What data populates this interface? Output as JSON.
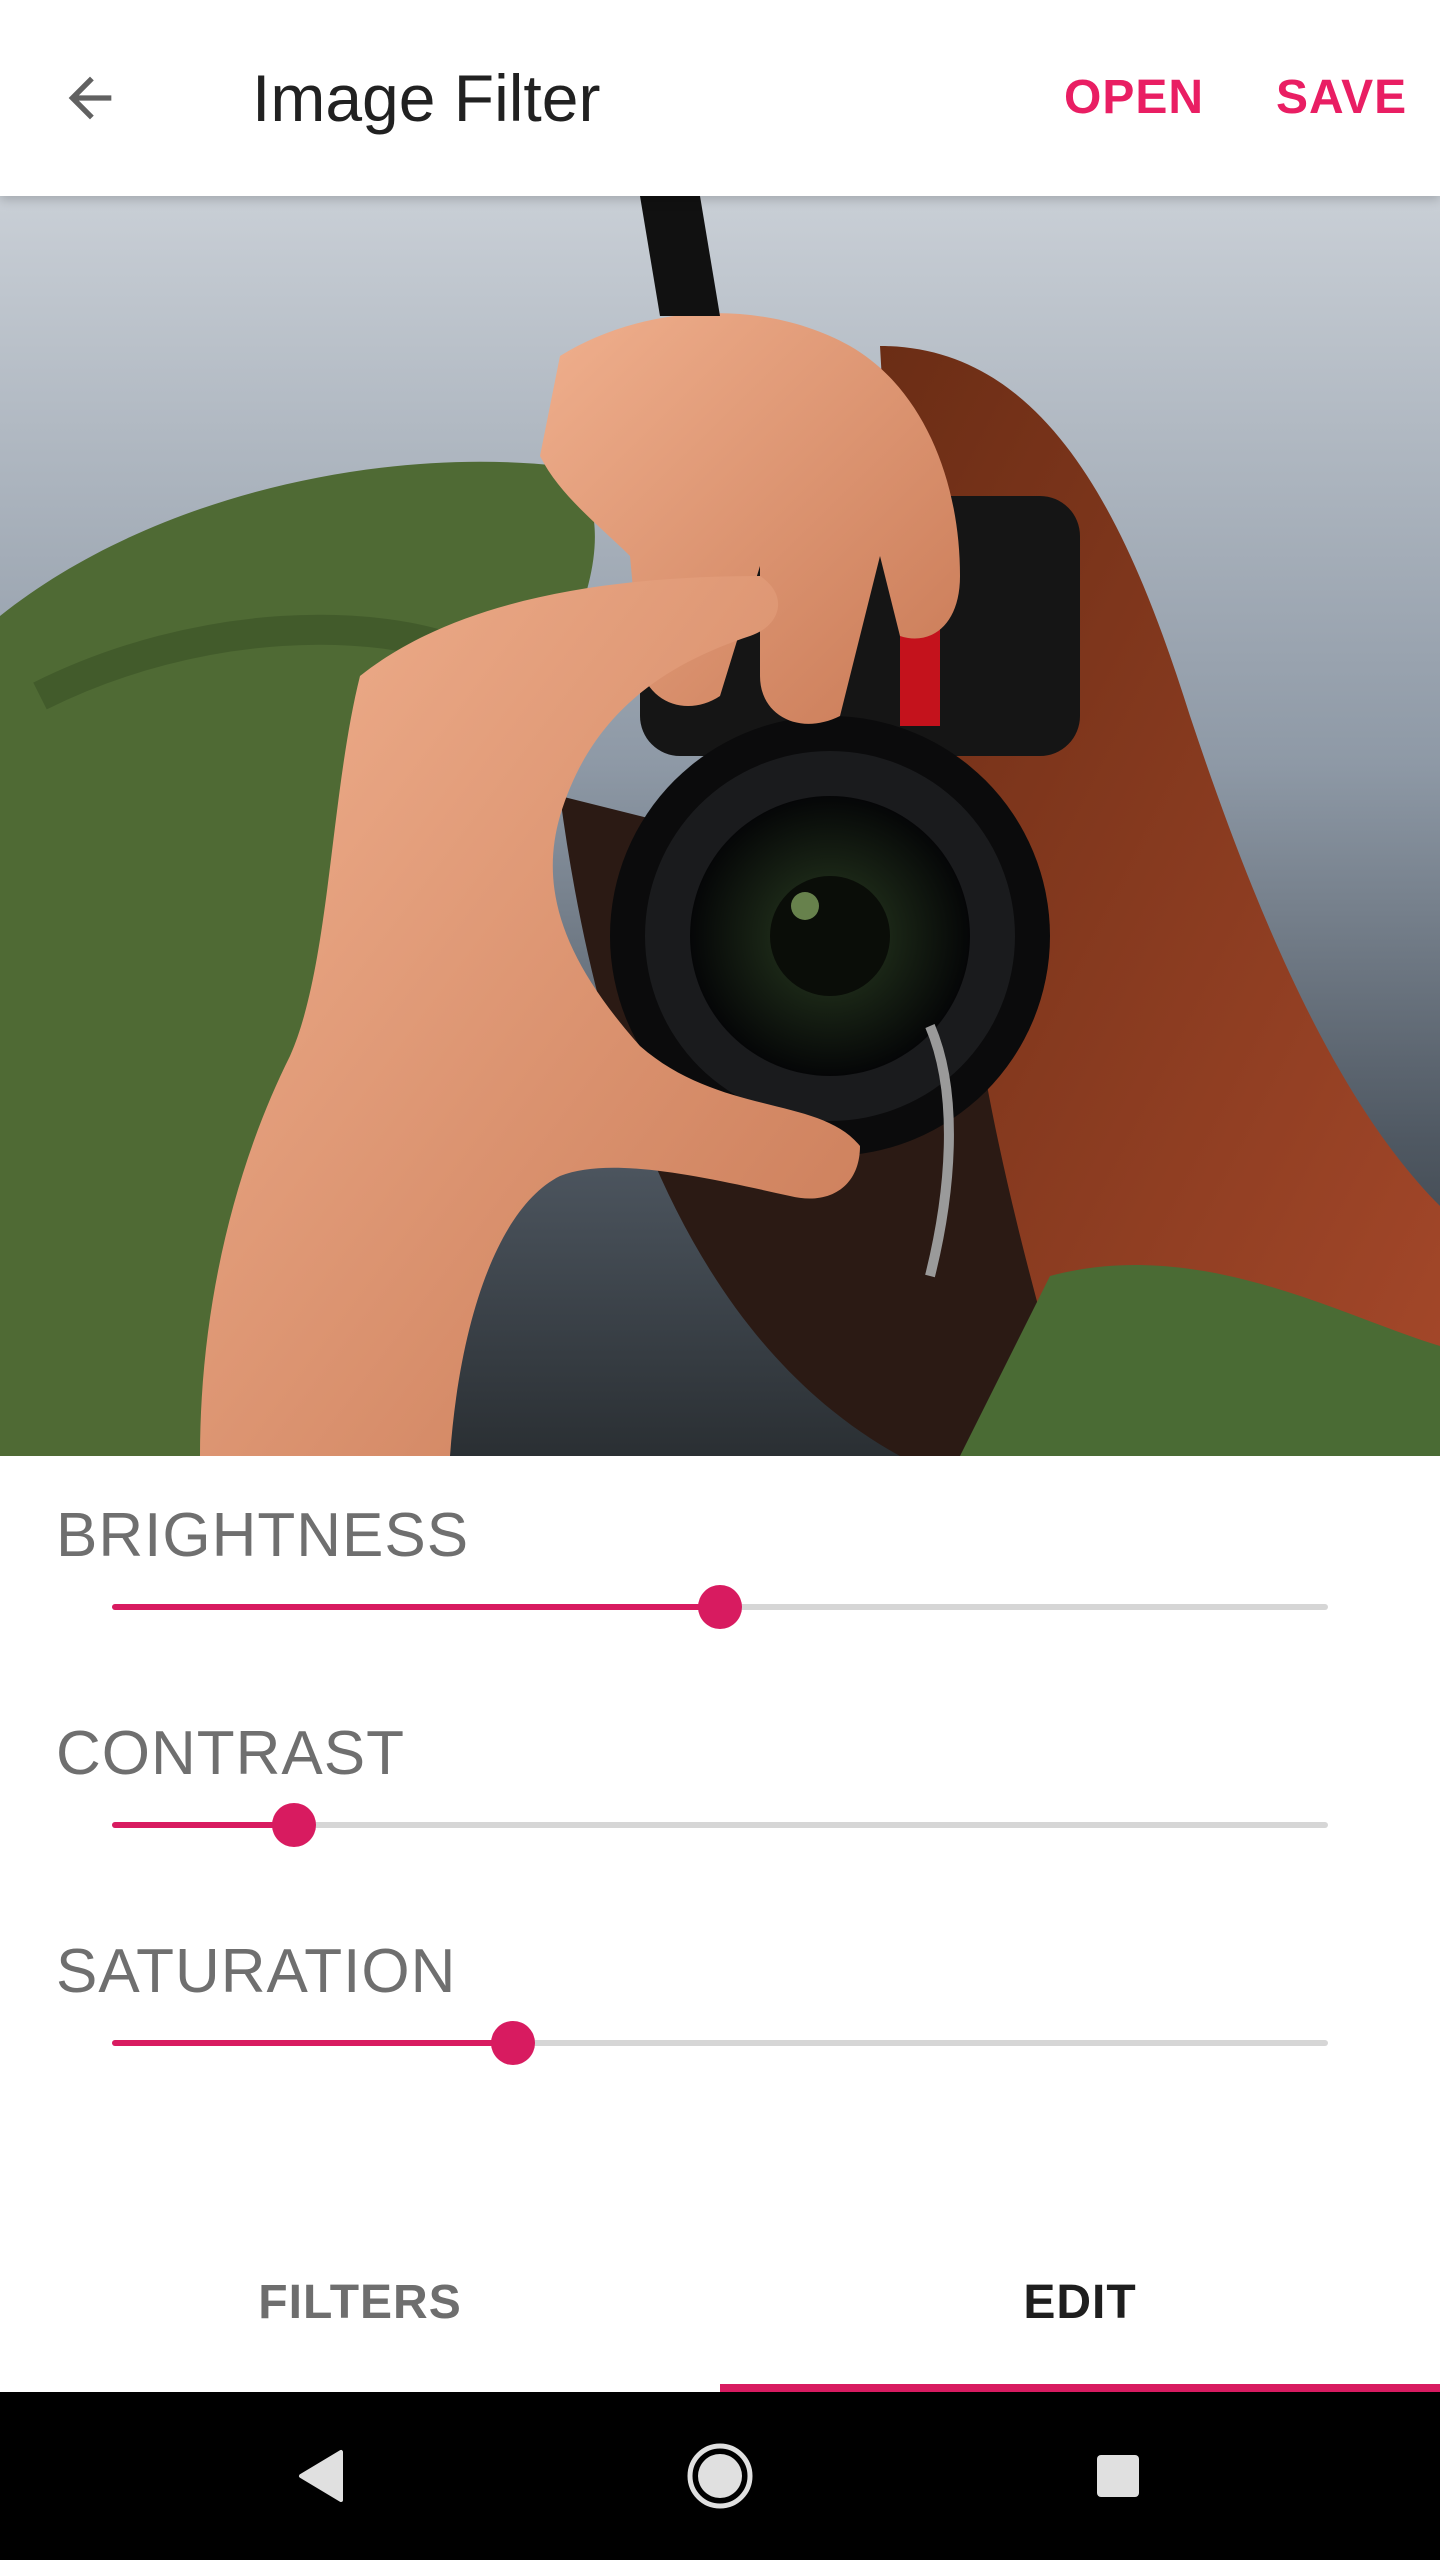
{
  "app_bar": {
    "title": "Image Filter",
    "open_label": "OPEN",
    "save_label": "SAVE",
    "back_icon": "arrow-back-icon"
  },
  "colors": {
    "accent": "#E91E63",
    "slider_accent": "#D81B60",
    "track": "#D6D6D6"
  },
  "photo": {
    "subject": "photo"
  },
  "adjustments": [
    {
      "label": "BRIGHTNESS",
      "value": 0.5
    },
    {
      "label": "CONTRAST",
      "value": 0.15
    },
    {
      "label": "SATURATION",
      "value": 0.33
    }
  ],
  "tabs": [
    {
      "label": "FILTERS",
      "selected": false
    },
    {
      "label": "EDIT",
      "selected": true
    }
  ],
  "navbar": {
    "back_icon": "nav-back-triangle-icon",
    "home_icon": "nav-home-circle-icon",
    "recent_icon": "nav-recent-square-icon"
  }
}
